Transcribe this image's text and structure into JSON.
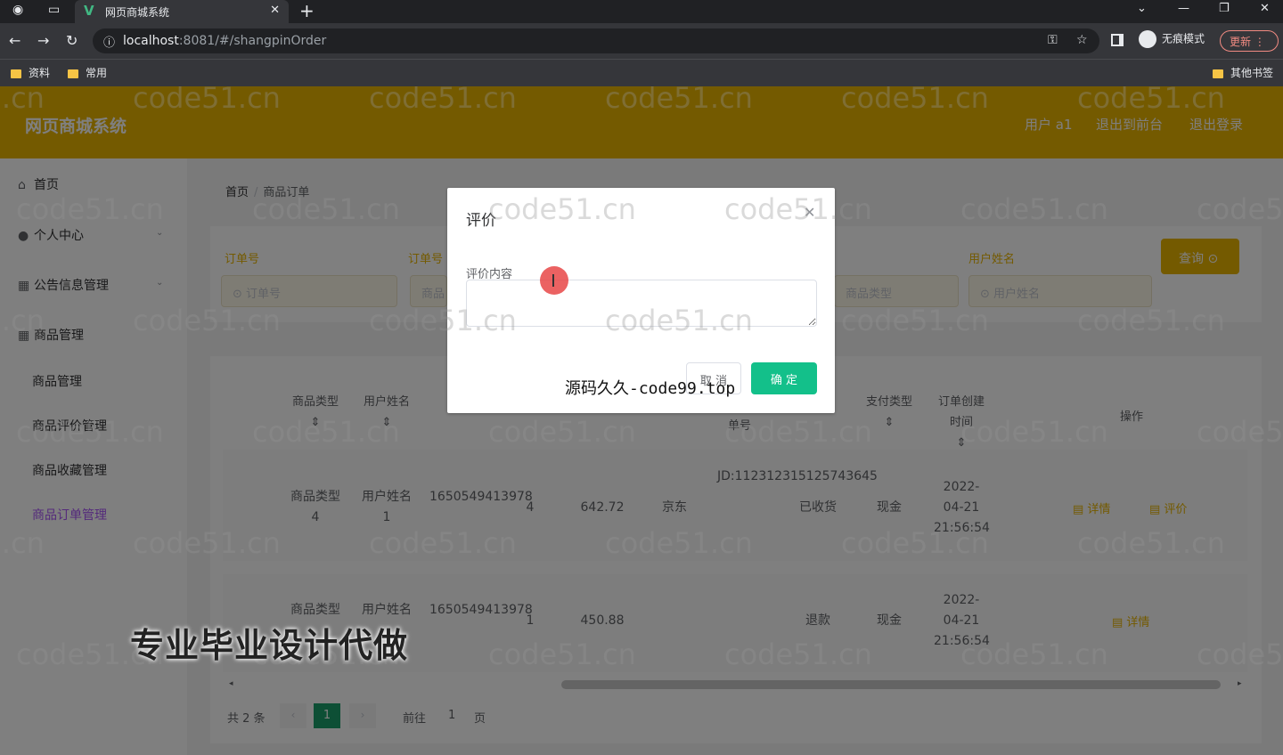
{
  "browser": {
    "tab_title": "网页商城系统",
    "url_host": "localhost",
    "url_rest": ":8081/#/shangpinOrder",
    "incognito_label": "无痕模式",
    "update_label": "更新",
    "bookmarks": [
      "资料",
      "常用"
    ],
    "other_bookmarks": "其他书签"
  },
  "header": {
    "title": "网页商城系统",
    "user": "用户 a1",
    "back_to_front": "退出到前台",
    "logout": "退出登录"
  },
  "sidebar": {
    "home": "首页",
    "personal": "个人中心",
    "notice": "公告信息管理",
    "goods": "商品管理",
    "sub": [
      "商品管理",
      "商品评价管理",
      "商品收藏管理",
      "商品订单管理"
    ]
  },
  "breadcrumb": {
    "home": "首页",
    "current": "商品订单"
  },
  "search": {
    "order_no_label": "订单号",
    "order_no_placeholder": "订单号",
    "label2": "订单号",
    "placeholder2": "商品",
    "type_placeholder": "商品类型",
    "user_label": "用户姓名",
    "user_placeholder": "用户姓名",
    "query": "查询"
  },
  "table": {
    "headers": [
      "商品类型",
      "用户姓名",
      "单号",
      "支付类型",
      "订单创建时间",
      "操作"
    ],
    "rows": [
      {
        "type": "商品类型4",
        "user": "用户姓名1",
        "order": "1650549413978",
        "qty": "4",
        "price": "642.72",
        "courier": "京东",
        "track": "JD:112312315125743645",
        "status": "已收货",
        "pay": "现金",
        "time": "2022-04-21 21:56:54",
        "ops": [
          "详情",
          "评价"
        ]
      },
      {
        "type": "商品类型",
        "user": "用户姓名",
        "order": "1650549413978",
        "qty": "1",
        "price": "450.88",
        "courier": "",
        "track": "",
        "status": "退款",
        "pay": "现金",
        "time": "2022-04-21 21:56:54",
        "ops": [
          "详情"
        ]
      }
    ]
  },
  "pager": {
    "total": "共 2 条",
    "current": "1",
    "goto": "前往",
    "page_input": "1",
    "page_unit": "页"
  },
  "dialog": {
    "title": "评价",
    "field_label": "评价内容",
    "cancel": "取 消",
    "confirm": "确 定"
  },
  "overlay": {
    "watermark": "code51.cn",
    "mid_text": "源码久久-code99.top",
    "big_text": "专业毕业设计代做"
  }
}
